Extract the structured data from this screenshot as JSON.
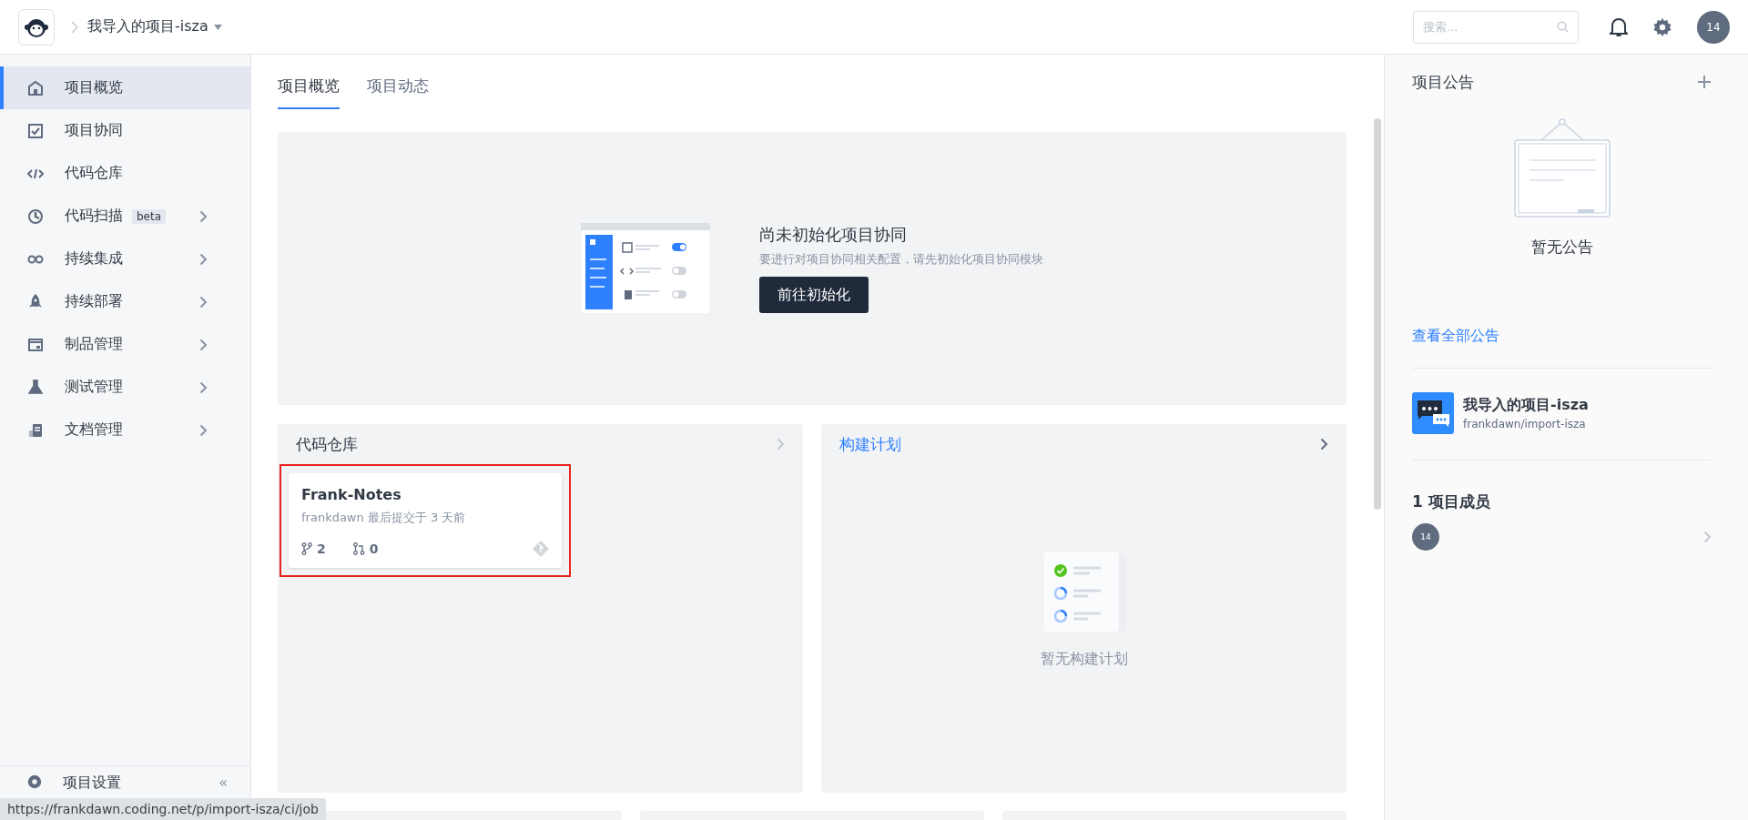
{
  "header": {
    "project": "我导入的项目-isza",
    "search": {
      "placeholder": "搜索..."
    },
    "avatar": "14"
  },
  "sidebar": {
    "items": [
      {
        "label": "项目概览",
        "selected": true,
        "expandable": false
      },
      {
        "label": "项目协同",
        "selected": false,
        "expandable": false
      },
      {
        "label": "代码仓库",
        "selected": false,
        "expandable": false
      },
      {
        "label": "代码扫描",
        "badge": "beta",
        "selected": false,
        "expandable": true
      },
      {
        "label": "持续集成",
        "selected": false,
        "expandable": true
      },
      {
        "label": "持续部署",
        "selected": false,
        "expandable": true
      },
      {
        "label": "制品管理",
        "selected": false,
        "expandable": true
      },
      {
        "label": "测试管理",
        "selected": false,
        "expandable": true
      },
      {
        "label": "文档管理",
        "selected": false,
        "expandable": true
      }
    ],
    "footer": {
      "label": "项目设置",
      "collapse": "«"
    }
  },
  "tabs": [
    {
      "label": "项目概览",
      "selected": true
    },
    {
      "label": "项目动态",
      "selected": false
    }
  ],
  "banner": {
    "title": "尚未初始化项目协同",
    "description": "要进行对项目协同相关配置，请先初始化项目协同模块",
    "button": "前往初始化"
  },
  "repo_panel": {
    "title": "代码仓库",
    "repos": [
      {
        "name": "Frank-Notes",
        "meta": "frankdawn 最后提交于 3 天前",
        "branches": "2",
        "merge_requests": "0",
        "highlighted": true
      }
    ]
  },
  "build_panel": {
    "title": "构建计划",
    "empty_text": "暂无构建计划"
  },
  "announcements": {
    "title": "项目公告",
    "empty_text": "暂无公告",
    "link": "查看全部公告"
  },
  "project": {
    "name": "我导入的项目-isza",
    "path": "frankdawn/import-isza"
  },
  "members": {
    "title": "1 项目成员",
    "avatars": [
      "14"
    ]
  },
  "status_bar": {
    "url": "https://frankdawn.coding.net/p/import-isza/ci/job"
  }
}
